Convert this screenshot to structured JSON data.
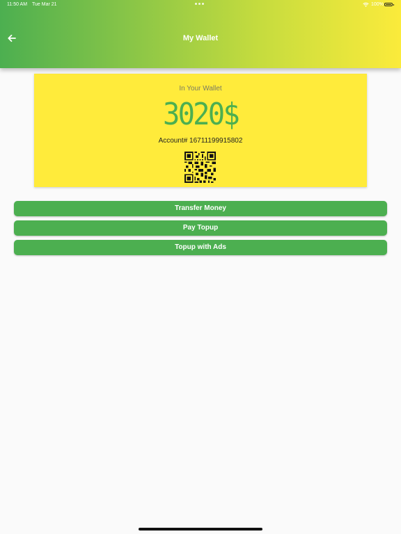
{
  "status_bar": {
    "time": "11:50 AM",
    "date": "Tue Mar 21",
    "battery": "100%",
    "icons": [
      "wifi-icon",
      "battery-icon"
    ]
  },
  "header": {
    "title": "My Wallet",
    "back_icon": "arrow-left-icon",
    "gradient": [
      "#4caf50",
      "#fbeb3b"
    ]
  },
  "wallet": {
    "label": "In Your Wallet",
    "balance": "3020$",
    "account": "Account# 16711199915802",
    "qr_icon": "qr-code-icon",
    "background": "#ffeb3b",
    "balance_color": "#4caf50"
  },
  "actions": [
    {
      "label": "Transfer Money"
    },
    {
      "label": "Pay Topup"
    },
    {
      "label": "Topup with Ads"
    }
  ],
  "colors": {
    "accent": "#4caf50",
    "background": "#fafafa"
  }
}
